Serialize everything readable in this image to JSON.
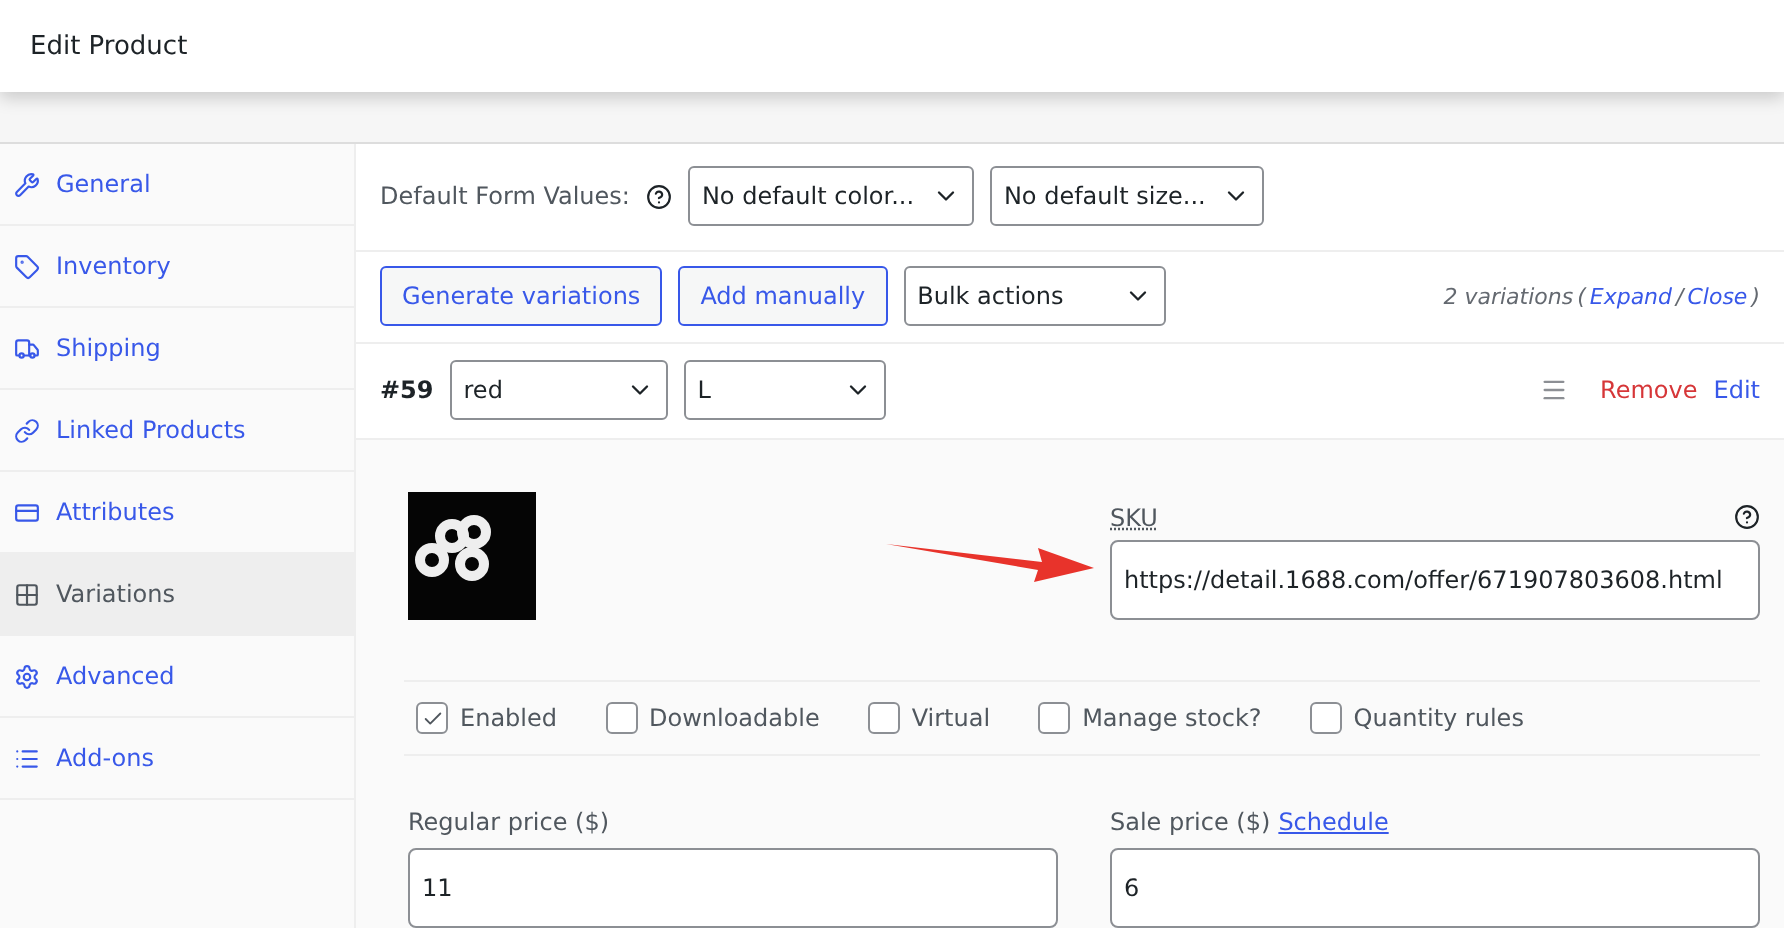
{
  "window": {
    "title": "Edit Product"
  },
  "sidebar": {
    "items": [
      {
        "label": "General",
        "selected": false
      },
      {
        "label": "Inventory",
        "selected": false
      },
      {
        "label": "Shipping",
        "selected": false
      },
      {
        "label": "Linked Products",
        "selected": false
      },
      {
        "label": "Attributes",
        "selected": false
      },
      {
        "label": "Variations",
        "selected": true
      },
      {
        "label": "Advanced",
        "selected": false
      },
      {
        "label": "Add-ons",
        "selected": false
      }
    ]
  },
  "default_form": {
    "label": "Default Form Values:",
    "selects": [
      "No default color...",
      "No default size..."
    ]
  },
  "toolbar": {
    "buttons": [
      "Generate variations",
      "Add manually"
    ],
    "bulk": "Bulk actions",
    "count": "2 variations",
    "open_paren": "(",
    "expand": "Expand",
    "separator": "/",
    "close": "Close",
    "close_paren": ")"
  },
  "variation": {
    "id": "#59",
    "selects": [
      "red",
      "L"
    ],
    "remove": "Remove",
    "edit": "Edit",
    "sku_label": "SKU",
    "sku": "https://detail.1688.com/offer/671907803608.html",
    "options": [
      {
        "label": "Enabled",
        "checked": true
      },
      {
        "label": "Downloadable",
        "checked": false
      },
      {
        "label": "Virtual",
        "checked": false
      },
      {
        "label": "Manage stock?",
        "checked": false
      },
      {
        "label": "Quantity rules",
        "checked": false
      }
    ],
    "regular_label": "Regular price ($)",
    "regular": "11",
    "sale_label": "Sale price ($)",
    "schedule": "Schedule",
    "sale": "6"
  }
}
